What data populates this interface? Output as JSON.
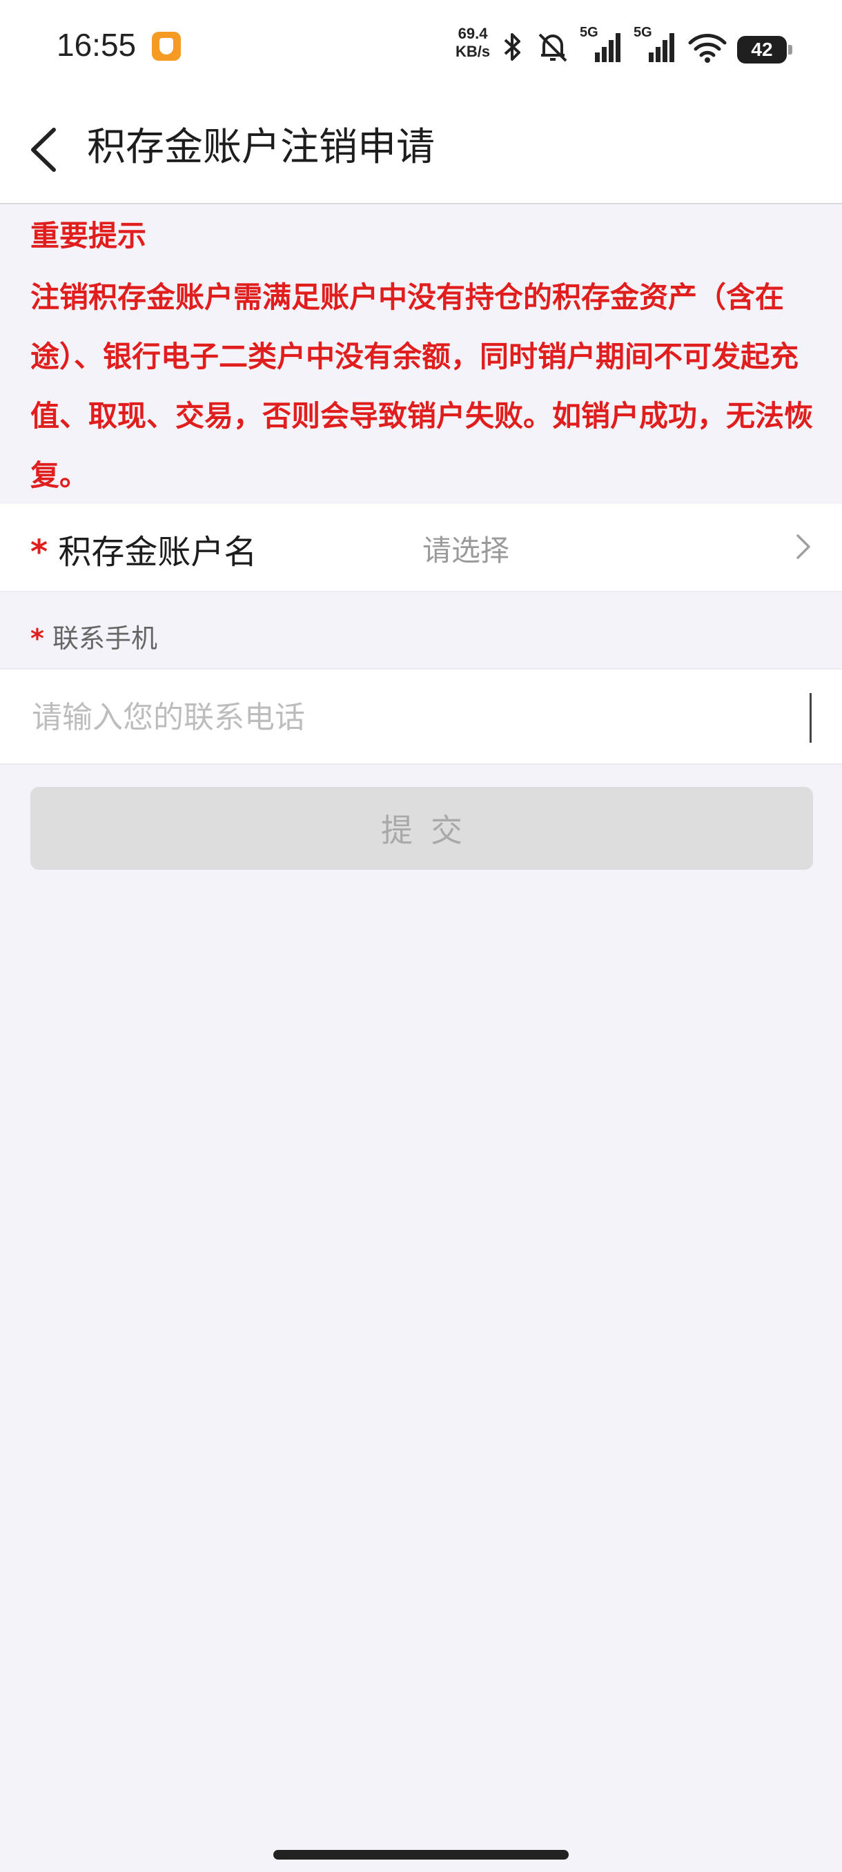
{
  "status_bar": {
    "time": "16:55",
    "net_speed_value": "69.4",
    "net_speed_unit": "KB/s",
    "signal_1": "5G",
    "signal_2": "5G",
    "battery": "42",
    "icons": [
      "bluetooth-icon",
      "mute-bell-icon",
      "signal-5g-icon",
      "signal-5g-icon",
      "wifi-icon",
      "battery-icon"
    ]
  },
  "header": {
    "title": "积存金账户注销申请"
  },
  "notice": {
    "title": "重要提示",
    "body": "注销积存金账户需满足账户中没有持仓的积存金资产（含在途）、银行电子二类户中没有余额，同时销户期间不可发起充值、取现、交易，否则会导致销户失败。如销户成功，无法恢复。",
    "color": "#e11e1e"
  },
  "form": {
    "required_mark": "*",
    "account_label": "积存金账户名",
    "account_value": "请选择",
    "phone_label": "联系手机",
    "phone_placeholder": "请输入您的联系电话",
    "submit_label": "提交"
  }
}
